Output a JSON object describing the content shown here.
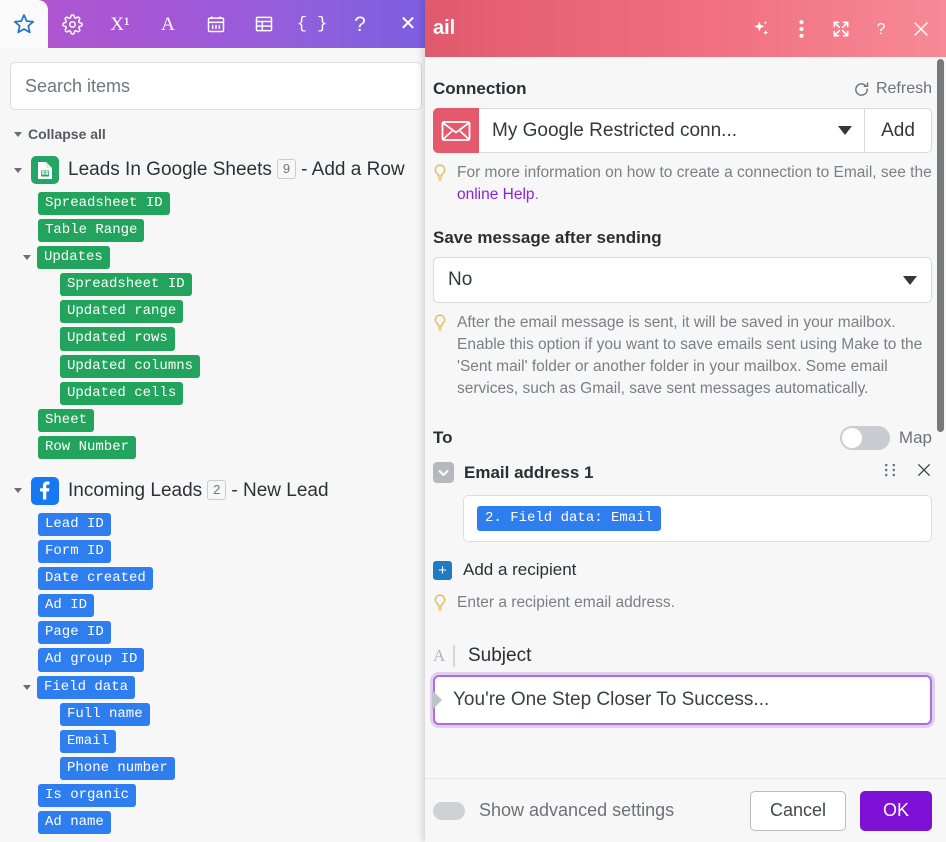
{
  "left_panel": {
    "toolbar": {
      "tabs": [
        {
          "name": "favorites",
          "icon": "star-icon",
          "active": true
        },
        {
          "name": "settings",
          "icon": "gear-icon",
          "active": false
        },
        {
          "name": "math",
          "icon": "x-superscript-icon",
          "label": "X¹",
          "active": false
        },
        {
          "name": "text",
          "icon": "letter-a-icon",
          "label": "A",
          "active": false
        },
        {
          "name": "date",
          "icon": "calendar-icon",
          "active": false
        },
        {
          "name": "array",
          "icon": "table-icon",
          "active": false
        },
        {
          "name": "general",
          "icon": "braces-icon",
          "label": "{ }",
          "active": false
        },
        {
          "name": "help",
          "icon": "question-mark-icon",
          "label": "?",
          "active": false
        },
        {
          "name": "close",
          "icon": "close-icon",
          "label": "✕",
          "active": false
        }
      ]
    },
    "search": {
      "placeholder": "Search items",
      "value": ""
    },
    "collapse_all_label": "Collapse all",
    "groups": [
      {
        "icon": "google-sheets-icon",
        "color": "#23a566",
        "title": "Leads In Google Sheets",
        "badge": "9",
        "suffix": "- Add a Row",
        "expanded": true,
        "items": [
          {
            "label": "Spreadsheet ID",
            "level": 1
          },
          {
            "label": "Table Range",
            "level": 1
          },
          {
            "label": "Updates",
            "level": 1,
            "expandable": true,
            "expanded": true
          },
          {
            "label": "Spreadsheet ID",
            "level": 2
          },
          {
            "label": "Updated range",
            "level": 2
          },
          {
            "label": "Updated rows",
            "level": 2
          },
          {
            "label": "Updated columns",
            "level": 2
          },
          {
            "label": "Updated cells",
            "level": 2
          },
          {
            "label": "Sheet",
            "level": 1
          },
          {
            "label": "Row Number",
            "level": 1
          }
        ]
      },
      {
        "icon": "facebook-icon",
        "color": "#1877f2",
        "title": "Incoming Leads",
        "badge": "2",
        "suffix": "- New Lead",
        "expanded": true,
        "items": [
          {
            "label": "Lead ID",
            "level": 1
          },
          {
            "label": "Form ID",
            "level": 1
          },
          {
            "label": "Date created",
            "level": 1
          },
          {
            "label": "Ad ID",
            "level": 1
          },
          {
            "label": "Page ID",
            "level": 1
          },
          {
            "label": "Ad group ID",
            "level": 1
          },
          {
            "label": "Field data",
            "level": 1,
            "expandable": true,
            "expanded": true
          },
          {
            "label": "Full name",
            "level": 2
          },
          {
            "label": "Email",
            "level": 2
          },
          {
            "label": "Phone number",
            "level": 2
          },
          {
            "label": "Is organic",
            "level": 1
          },
          {
            "label": "Ad name",
            "level": 1
          }
        ]
      }
    ]
  },
  "right_panel": {
    "header": {
      "title": "ail",
      "actions": [
        {
          "name": "ai-sparkle-icon"
        },
        {
          "name": "more-vertical-icon"
        },
        {
          "name": "expand-icon"
        },
        {
          "name": "help-icon"
        },
        {
          "name": "close-icon"
        }
      ]
    },
    "connection": {
      "section_label": "Connection",
      "refresh_label": "Refresh",
      "icon": "envelope-icon",
      "selected": "My Google Restricted conn...",
      "add_label": "Add",
      "hint_prefix": "For more information on how to create a connection to Email, see the ",
      "hint_link": "online Help",
      "hint_suffix": "."
    },
    "save_message": {
      "label": "Save message after sending",
      "value": "No",
      "hint": "After the email message is sent, it will be saved in your mailbox. Enable this option if you want to save emails sent using Make to the 'Sent mail' folder or another folder in your mailbox. Some email services, such as Gmail, save sent messages automatically."
    },
    "to": {
      "label": "To",
      "map_label": "Map",
      "map_on": false,
      "recipient_title": "Email address 1",
      "mapped_value": "2. Field data: Email",
      "add_recipient_label": "Add a recipient",
      "add_hint": "Enter a recipient email address."
    },
    "subject": {
      "label": "Subject",
      "value": "You're One Step Closer To Success...",
      "placeholder": ""
    },
    "footer": {
      "advanced_label": "Show advanced settings",
      "advanced_on": false,
      "cancel_label": "Cancel",
      "ok_label": "OK",
      "ok_color": "#7f11d6"
    }
  }
}
